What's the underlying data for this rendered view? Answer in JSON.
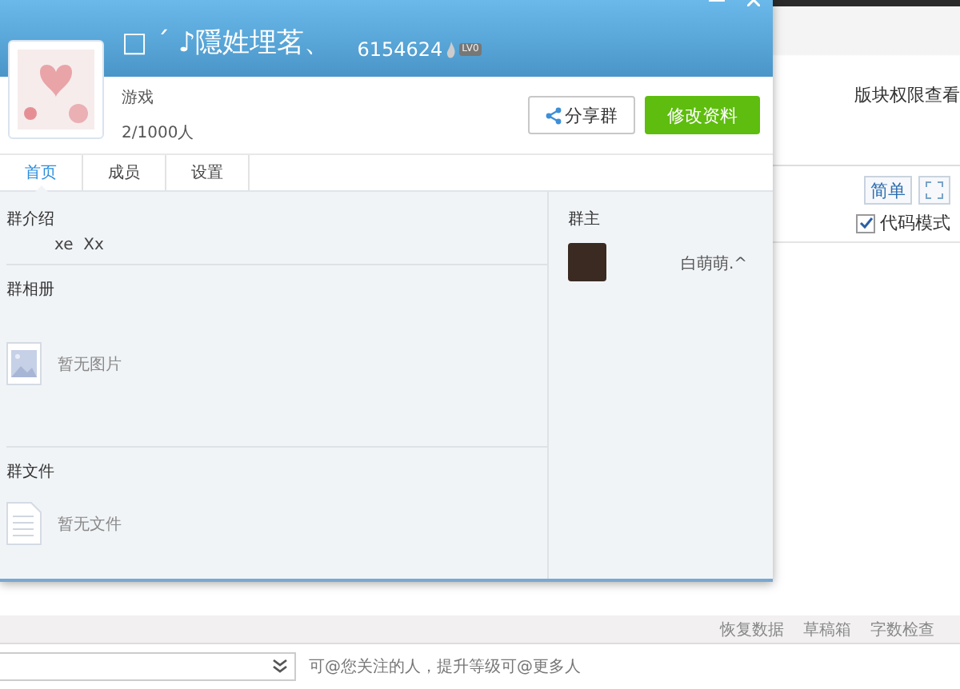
{
  "page": {
    "permission_link": "版块权限查看",
    "toolbar": {
      "simple_button": "简单",
      "code_mode": {
        "label": "代码模式",
        "checked": true
      }
    },
    "bottom_bar": [
      "恢复数据",
      "草稿箱",
      "字数检查"
    ],
    "mention_hint": "可@您关注的人，提升等级可@更多人"
  },
  "dialog": {
    "group_name": "□ ˊ ♪隱姓埋茗、",
    "group_number": "6154624",
    "level_badge": "LV0",
    "category": "游戏",
    "members": "2/1000人",
    "share_button": "分享群",
    "edit_button": "修改资料",
    "tabs": [
      {
        "label": "首页",
        "selected": true
      },
      {
        "label": "成员",
        "selected": false
      },
      {
        "label": "设置",
        "selected": false
      }
    ],
    "sections": [
      {
        "kind": "text",
        "title": "群介绍",
        "text": "xe  Xx"
      },
      {
        "kind": "image",
        "title": "群相册",
        "empty_text": "暂无图片"
      },
      {
        "kind": "file",
        "title": "群文件",
        "empty_text": "暂无文件"
      }
    ],
    "owner": {
      "title": "群主",
      "name": "白萌萌.^"
    }
  }
}
